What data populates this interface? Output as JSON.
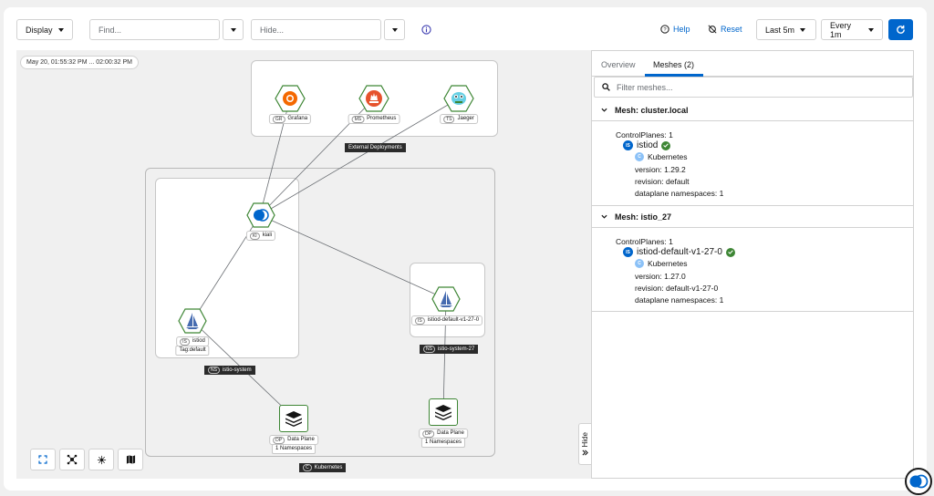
{
  "toolbar": {
    "display_label": "Display",
    "find_placeholder": "Find...",
    "hide_placeholder": "Hide...",
    "help_label": "Help",
    "reset_label": "Reset",
    "duration_label": "Last 5m",
    "refresh_label": "Every 1m"
  },
  "graph": {
    "timestamp": "May 20, 01:55:32 PM ... 02:00:32 PM",
    "external_label": "External Deployments",
    "nodes": {
      "grafana": {
        "badge": "GR",
        "label": "Grafana"
      },
      "prometheus": {
        "badge": "MS",
        "label": "Prometheus"
      },
      "jaeger": {
        "badge": "TS",
        "label": "Jaeger"
      },
      "kiali": {
        "badge": "KI",
        "label": "kiali"
      },
      "istiod": {
        "badge": "IS",
        "label": "istiod",
        "tag": "Tag:default"
      },
      "istiod27": {
        "badge": "IS",
        "label": "istiod-default-v1-27-0"
      },
      "dp1": {
        "badge": "DP",
        "label": "Data Plane",
        "sub": "1 Namespaces"
      },
      "dp2": {
        "badge": "DP",
        "label": "Data Plane",
        "sub": "1 Namespaces"
      }
    },
    "ns_istio_system": {
      "badge": "NS",
      "label": "istio-system"
    },
    "ns_istio_system_27": {
      "badge": "NS",
      "label": "istio-system-27"
    },
    "cluster": {
      "badge": "C",
      "label": "Kubernetes"
    },
    "hide_label": "Hide"
  },
  "panel": {
    "tabs": [
      "Overview",
      "Meshes (2)"
    ],
    "filter_placeholder": "Filter meshes...",
    "meshes": [
      {
        "title": "Mesh: cluster.local",
        "control_planes": "ControlPlanes: 1",
        "cp_badge": "IS",
        "cp_name": "istiod",
        "cluster_badge": "C",
        "cluster": "Kubernetes",
        "version": "version: 1.29.2",
        "revision": "revision: default",
        "dataplane": "dataplane namespaces: 1"
      },
      {
        "title": "Mesh: istio_27",
        "control_planes": "ControlPlanes: 1",
        "cp_badge": "IS",
        "cp_name": "istiod-default-v1-27-0",
        "cluster_badge": "C",
        "cluster": "Kubernetes",
        "version": "version: 1.27.0",
        "revision": "revision: default-v1-27-0",
        "dataplane": "dataplane namespaces: 1"
      }
    ]
  },
  "colors": {
    "accent": "#0066cc",
    "node_border": "#3e8635",
    "success": "#3e8635",
    "dark_label": "#2b2b2b"
  }
}
